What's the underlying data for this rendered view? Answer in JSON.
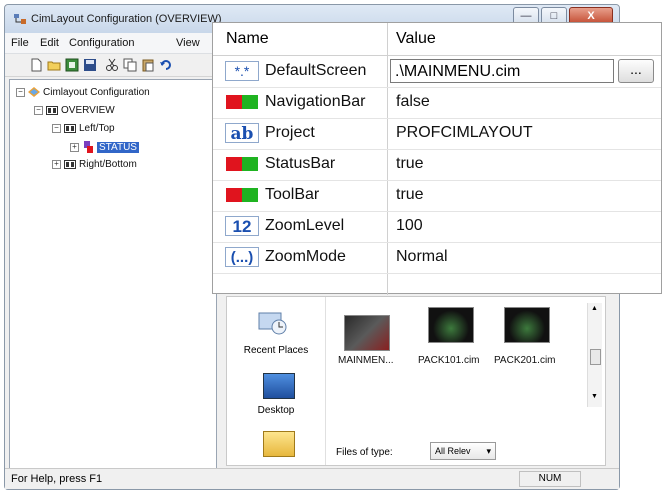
{
  "window": {
    "title": "CimLayout Configuration (OVERVIEW)",
    "caption_buttons": {
      "minimize": "—",
      "maximize": "□",
      "close": "X"
    }
  },
  "menu": {
    "file": "File",
    "edit": "Edit",
    "configuration": "Configuration",
    "view": "View"
  },
  "toolbar": {
    "icons": [
      "new-icon",
      "open-icon",
      "properties-icon",
      "save-icon",
      "cut-icon",
      "copy-icon",
      "paste-icon",
      "undo-icon"
    ]
  },
  "tree": {
    "root": "Cimlayout Configuration",
    "overview": "OVERVIEW",
    "left_top": "Left/Top",
    "status": "STATUS",
    "right_bottom": "Right/Bottom"
  },
  "statusbar": {
    "help": "For Help, press F1",
    "num": "NUM"
  },
  "file_dialog": {
    "places": {
      "recent": "Recent Places",
      "desktop": "Desktop"
    },
    "files": [
      "MAINMEN...",
      "PACK101.cim",
      "PACK201.cim"
    ],
    "filetype_label": "Files of type:",
    "filetype_value": "All Relev"
  },
  "property_grid": {
    "header": {
      "name": "Name",
      "value": "Value"
    },
    "rows": [
      {
        "icon": "screen-icon",
        "name": "DefaultScreen",
        "value": ".\\MAINMENU.cim",
        "button": "..."
      },
      {
        "icon": "boolean-icon",
        "name": "NavigationBar",
        "value": "false"
      },
      {
        "icon": "text-icon",
        "icon_text": "ab",
        "name": "Project",
        "value": "PROFCIMLAYOUT"
      },
      {
        "icon": "boolean-icon",
        "name": "StatusBar",
        "value": "true"
      },
      {
        "icon": "boolean-icon",
        "name": "ToolBar",
        "value": "true"
      },
      {
        "icon": "number-icon",
        "icon_text": "12",
        "name": "ZoomLevel",
        "value": "100"
      },
      {
        "icon": "enum-icon",
        "icon_text": "(...)",
        "name": "ZoomMode",
        "value": "Normal"
      }
    ]
  },
  "colors": {
    "selection": "#3166c8",
    "bool_red": "#e0141e",
    "bool_green": "#1fb321",
    "icon_blue": "#1a4fb0"
  }
}
